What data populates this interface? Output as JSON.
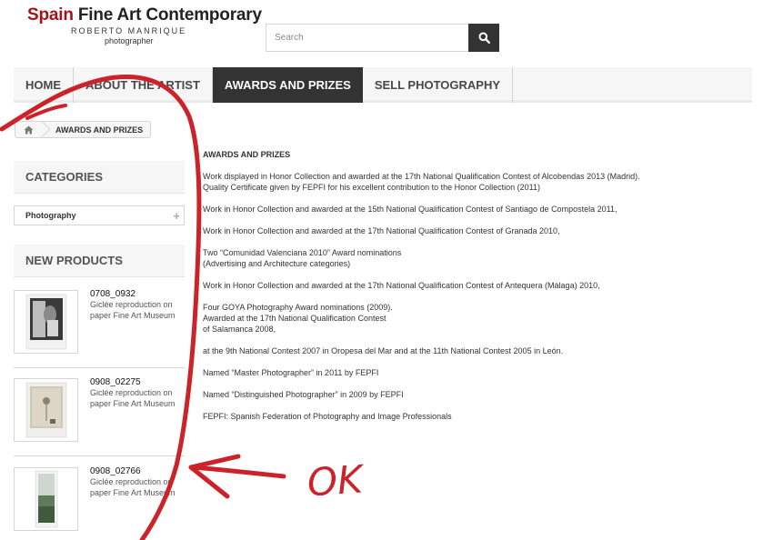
{
  "header": {
    "logo_title_red": "Spain",
    "logo_title_rest": "Fine Art Contemporary",
    "logo_subtitle": "ROBERTO MANRIQUE",
    "logo_tagline": "photographer"
  },
  "search": {
    "placeholder": "Search",
    "icon": "search-icon"
  },
  "nav": {
    "items": [
      {
        "label": "HOME"
      },
      {
        "label": "ABOUT THE ARTIST"
      },
      {
        "label": "AWARDS AND PRIZES",
        "active": true
      },
      {
        "label": "SELL PHOTOGRAPHY"
      }
    ]
  },
  "breadcrumb": {
    "home_icon": "home-icon",
    "current": "AWARDS AND PRIZES"
  },
  "sidebar": {
    "categories_title": "CATEGORIES",
    "categories": [
      {
        "label": "Photography"
      }
    ],
    "new_products_title": "NEW PRODUCTS",
    "products": [
      {
        "name": "0708_0932",
        "description": "Giclée reproduction on paper Fine Art Museum"
      },
      {
        "name": "0908_02275",
        "description": "Giclée reproduction on paper Fine Art Museum"
      },
      {
        "name": "0908_02766",
        "description": "Giclée reproduction on paper Fine Art Museum"
      }
    ]
  },
  "content": {
    "title": "AWARDS AND PRIZES",
    "paragraphs": [
      [
        "Work displayed in Honor Collection and awarded at the 17th National Qualification Contest of Alcobendas 2013 (Madrid).",
        "Quality Certificate given by FEPFI for his excellent contribution to the Honor Collection (2011)"
      ],
      [
        "Work in Honor Collection and awarded at the 15th National Qualification Contest of Santiago de Compostela 2011,"
      ],
      [
        "Work in Honor Collection and awarded at the 17th National Qualification Contest of Granada 2010,"
      ],
      [
        "Two “Comunidad Valenciana 2010” Award nominations",
        "(Advertising and Architecture categories)"
      ],
      [
        "Work in Honor Collection and awarded at the 17th National Qualification Contest of Antequera (Málaga) 2010,"
      ],
      [
        "Four GOYA Photography Award nominations (2009).",
        "Awarded at the 17th National Qualification Contest",
        "of Salamanca 2008,"
      ],
      [
        "at the 9th National Contest 2007 in Oropesa del Mar and at the 11th National Contest 2005 in León."
      ],
      [
        "Named “Master Photographer” in 2011 by FEPFI"
      ],
      [
        "Named “Distinguished Photographer” in 2009 by FEPFI"
      ],
      [
        "FEPFI: Spanish Federation of Photography and Image Professionals"
      ]
    ]
  },
  "annotation": {
    "text": "OK",
    "color": "#d0262a"
  },
  "colors": {
    "brand_red": "#a3131a",
    "nav_active_bg": "#333333",
    "nav_bg": "#f6f6f6"
  }
}
